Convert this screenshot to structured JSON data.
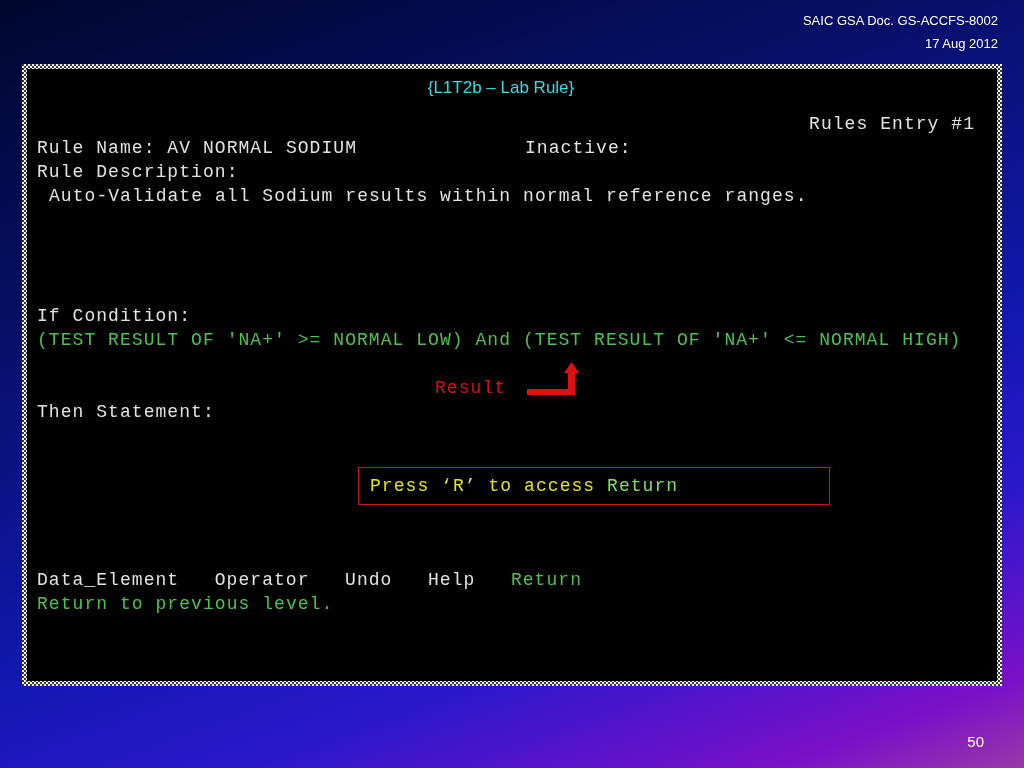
{
  "slide": {
    "doc_ref": "SAIC GSA Doc. GS-ACCFS-8002",
    "date": "17 Aug 2012",
    "page_number": "50"
  },
  "terminal": {
    "title": "{L1T2b – Lab Rule}",
    "entry": "Rules Entry #1",
    "rule_name": "Rule Name: AV NORMAL SODIUM",
    "inactive_label": "Inactive:",
    "description_label": "Rule Description:",
    "description": "Auto-Validate all Sodium results within normal reference ranges.",
    "if_label": "If Condition:",
    "condition": "(TEST RESULT OF 'NA+' >= NORMAL LOW) And (TEST RESULT OF 'NA+' <= NORMAL HIGH)",
    "then_label": "Then Statement:",
    "menu": [
      {
        "label": "Data_Element",
        "selected": false
      },
      {
        "label": "Operator",
        "selected": false
      },
      {
        "label": "Undo",
        "selected": false
      },
      {
        "label": "Help",
        "selected": false
      },
      {
        "label": "Return",
        "selected": true
      }
    ],
    "help": "Return to previous level."
  },
  "annotation": {
    "label": "Result"
  },
  "callout": {
    "text": "Press ‘R’ to access",
    "keyword": "Return"
  }
}
